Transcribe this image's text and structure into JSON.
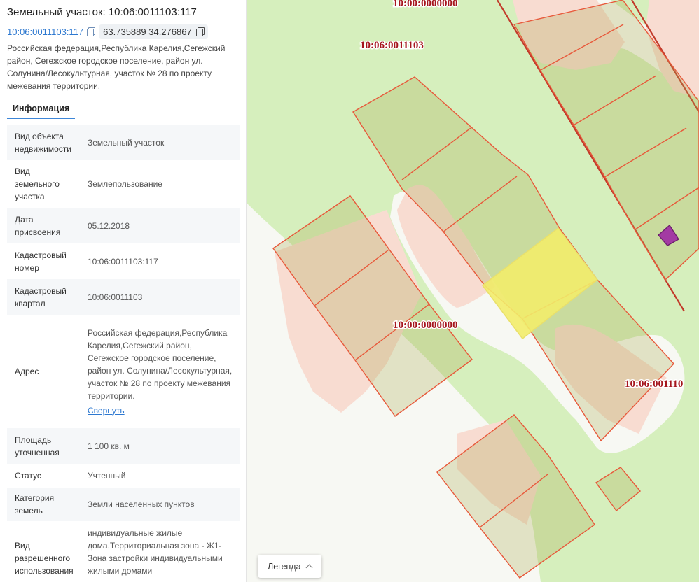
{
  "header": {
    "title": "Земельный участок: 10:06:0011103:117",
    "cadastral_link": "10:06:0011103:117",
    "coordinates": "63.735889 34.276867",
    "address": "Российская федерация,Республика Карелия,Сегежский район, Сегежское городское поселение, район ул. Солунина/Лесокультурная, участок № 28 по проекту межевания территории."
  },
  "tabs": [
    {
      "label": "Информация",
      "active": true
    }
  ],
  "info_rows": [
    {
      "key": "Вид объекта недвижимости",
      "value": "Земельный участок"
    },
    {
      "key": "Вид земельного участка",
      "value": "Землепользование"
    },
    {
      "key": "Дата присвоения",
      "value": "05.12.2018"
    },
    {
      "key": "Кадастровый номер",
      "value": "10:06:0011103:117"
    },
    {
      "key": "Кадастровый квартал",
      "value": "10:06:0011103"
    },
    {
      "key": "Адрес",
      "value": "Российская федерация,Республика Карелия,Сегежский район, Сегежское городское поселение, район ул. Солунина/Лесокультурная, участок № 28 по проекту межевания территории.",
      "link": "Свернуть"
    },
    {
      "key": "Площадь уточненная",
      "value": "1 100 кв. м"
    },
    {
      "key": "Статус",
      "value": "Учтенный"
    },
    {
      "key": "Категория земель",
      "value": "Земли населенных пунктов"
    },
    {
      "key": "Вид разрешенного использования",
      "value": "индивидуальные жилые дома.Территориальная зона - Ж1-Зона застройки индивидуальными жилыми домами"
    }
  ],
  "map": {
    "labels": [
      "10:00:0000000",
      "10:06:0011103",
      "10:00:0000000",
      "10:06:001110"
    ],
    "legend_label": "Легенда"
  },
  "colors": {
    "accent": "#2d78d0",
    "parcel_border": "#e8583a",
    "selected_parcel": "#f2ec6a",
    "label_text": "#a5161d"
  }
}
